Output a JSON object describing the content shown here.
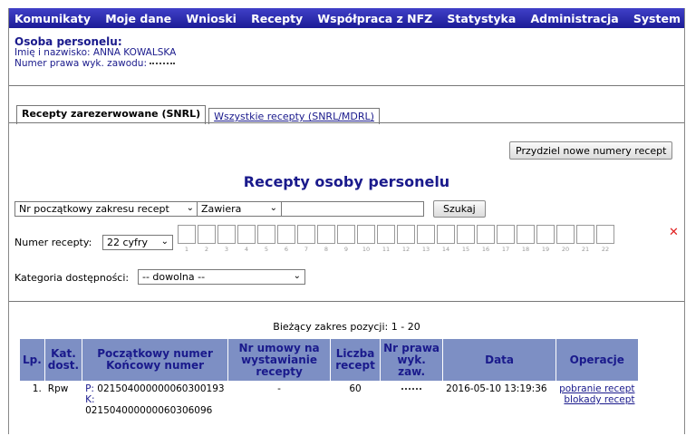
{
  "menu": [
    "Komunikaty",
    "Moje dane",
    "Wnioski",
    "Recepty",
    "Współpraca z NFZ",
    "Statystyka",
    "Administracja",
    "System"
  ],
  "person": {
    "title": "Osoba personelu:",
    "name_label": "Imię i nazwisko:",
    "name_value": "ANNA KOWALSKA",
    "license_label": "Numer prawa wyk. zawodu:"
  },
  "tabs": {
    "active": "Recepty zarezerwowane (SNRL)",
    "inactive": "Wszystkie recepty (SNRL/MDRL)"
  },
  "assign_button": "Przydziel nowe numery recept",
  "heading": "Recepty osoby personelu",
  "filter": {
    "field_select": "Nr początkowy zakresu recept",
    "mode_select": "Zawiera",
    "search_value": "",
    "search_button": "Szukaj"
  },
  "number": {
    "label": "Numer recepty:",
    "length_select": "22 cyfry",
    "digits": [
      "1",
      "2",
      "3",
      "4",
      "5",
      "6",
      "7",
      "8",
      "9",
      "10",
      "11",
      "12",
      "13",
      "14",
      "15",
      "16",
      "17",
      "18",
      "19",
      "20",
      "21",
      "22"
    ]
  },
  "category": {
    "label": "Kategoria dostępności:",
    "select": "-- dowolna --"
  },
  "range_text": "Bieżący zakres pozycji: 1 - 20",
  "table": {
    "headers": {
      "lp": "Lp.",
      "kat": "Kat. dost.",
      "start": "Początkowy numer",
      "end": "Końcowy numer",
      "contract": "Nr umowy na wystawianie recepty",
      "count": "Liczba recept",
      "license": "Nr prawa wyk. zaw.",
      "date": "Data",
      "ops": "Operacje"
    },
    "rows": [
      {
        "lp": "1.",
        "kat": "Rpw",
        "p_prefix": "P:",
        "start": "021504000000060300193",
        "k_prefix": "K:",
        "end": "021504000000060306096",
        "contract": "-",
        "count": "60",
        "date": "2016-05-10 13:19:36",
        "op1": "pobranie recept",
        "op2": "blokady recept"
      }
    ]
  }
}
